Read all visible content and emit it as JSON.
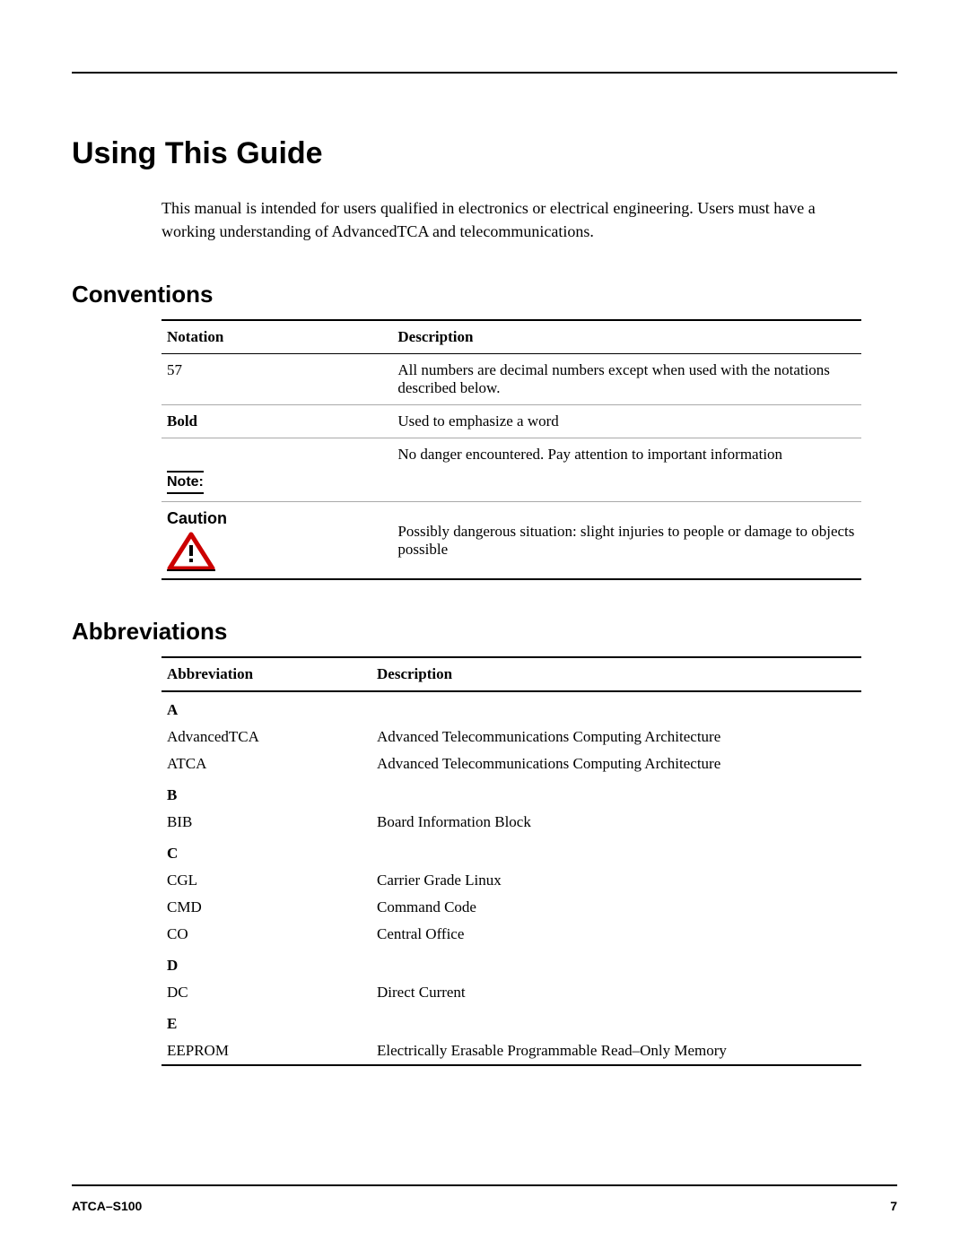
{
  "page_title": "Using This Guide",
  "intro": "This manual is intended for users qualified in electronics or electrical engineering. Users must have a working understanding of AdvancedTCA and telecommunications.",
  "conventions": {
    "heading": "Conventions",
    "columns": {
      "notation": "Notation",
      "description": "Description"
    },
    "rows": [
      {
        "notation": "57",
        "description": "All numbers are decimal numbers except when used with the notations described below."
      },
      {
        "notation_bold": "Bold",
        "description": "Used to emphasize a word"
      },
      {
        "note_label": "Note:",
        "description": "No danger encountered. Pay attention to important information"
      },
      {
        "caution_label": "Caution",
        "description": "Possibly dangerous situation: slight injuries to people or damage to objects possible"
      }
    ]
  },
  "abbreviations": {
    "heading": "Abbreviations",
    "columns": {
      "abbr": "Abbreviation",
      "description": "Description"
    },
    "sections": [
      {
        "letter": "A",
        "rows": [
          {
            "abbr": "AdvancedTCA",
            "desc": "Advanced Telecommunications Computing Architecture"
          },
          {
            "abbr": "ATCA",
            "desc": "Advanced Telecommunications Computing Architecture"
          }
        ]
      },
      {
        "letter": "B",
        "rows": [
          {
            "abbr": "BIB",
            "desc": "Board Information Block"
          }
        ]
      },
      {
        "letter": "C",
        "rows": [
          {
            "abbr": "CGL",
            "desc": "Carrier Grade Linux"
          },
          {
            "abbr": "CMD",
            "desc": "Command Code"
          },
          {
            "abbr": "CO",
            "desc": "Central Office"
          }
        ]
      },
      {
        "letter": "D",
        "rows": [
          {
            "abbr": "DC",
            "desc": "Direct Current"
          }
        ]
      },
      {
        "letter": "E",
        "rows": [
          {
            "abbr": "EEPROM",
            "desc": "Electrically Erasable Programmable Read–Only Memory"
          }
        ]
      }
    ]
  },
  "footer": {
    "left": "ATCA–S100",
    "right": "7"
  }
}
